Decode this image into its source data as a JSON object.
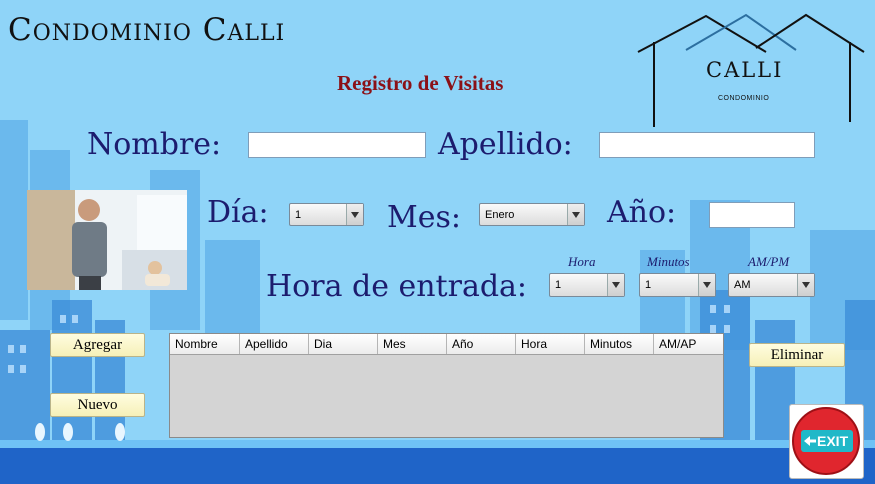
{
  "app": {
    "title": "Condominio Calli",
    "subtitle": "Registro de Visitas"
  },
  "logo": {
    "name": "CALLI",
    "sub": "CONDOMINIO"
  },
  "form": {
    "nombre_label": "Nombre:",
    "nombre_value": "",
    "apellido_label": "Apellido:",
    "apellido_value": "",
    "dia_label": "Día:",
    "dia_value": "1",
    "mes_label": "Mes:",
    "mes_value": "Enero",
    "anio_label": "Año:",
    "anio_value": "",
    "hora_label": "Hora de entrada:",
    "hora_small": "Hora",
    "hora_value": "1",
    "minutos_small": "Minutos",
    "minutos_value": "1",
    "ampm_small": "AM/PM",
    "ampm_value": "AM"
  },
  "buttons": {
    "agregar": "Agregar",
    "nuevo": "Nuevo",
    "eliminar": "Eliminar",
    "exit": "EXIT"
  },
  "table": {
    "columns": [
      "Nombre",
      "Apellido",
      "Dia",
      "Mes",
      "Año",
      "Hora",
      "Minutos",
      "AM/AP"
    ],
    "rows": []
  },
  "icons": {
    "exit": "exit-icon",
    "photo": "visitor-photo"
  },
  "colors": {
    "background": "#8fd4f8",
    "title": "#8b1117",
    "label": "#1c1c6e",
    "button": "#fbf6c8",
    "exit": "#e0262e"
  }
}
